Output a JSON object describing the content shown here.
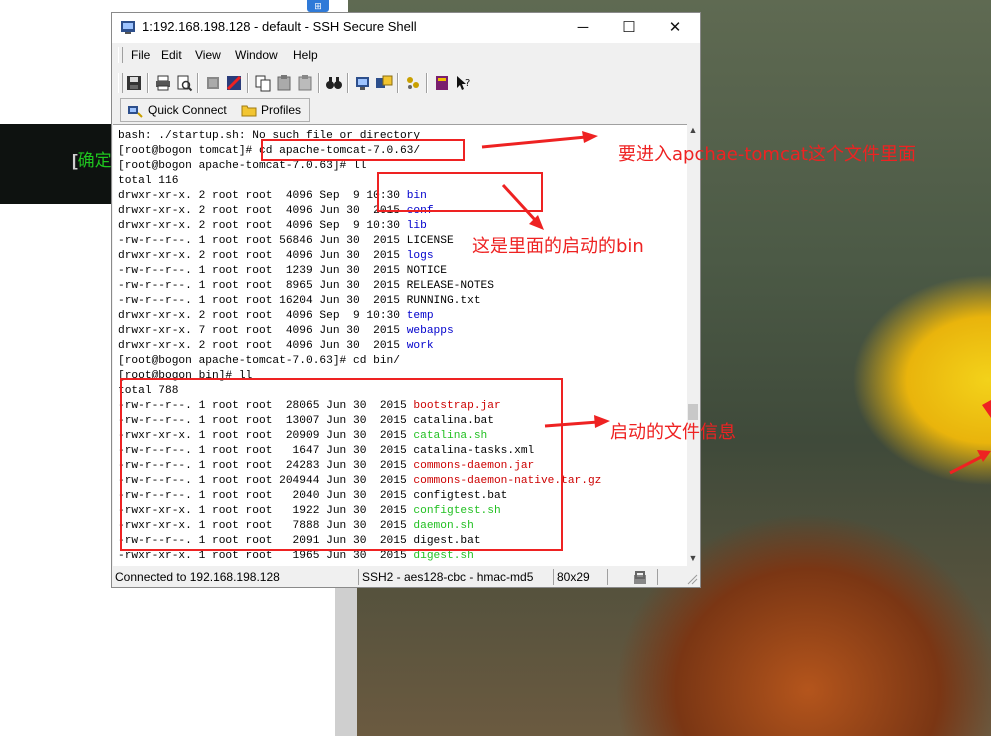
{
  "window": {
    "title": "1:192.168.198.128 - default - SSH Secure Shell",
    "min_glyph": "─",
    "max_glyph": "☐",
    "close_glyph": "✕"
  },
  "menu": [
    "File",
    "Edit",
    "View",
    "Window",
    "Help"
  ],
  "toolbar_icons": [
    "save-icon",
    "print-icon",
    "print-preview-icon",
    "find-icon",
    "settings-icon",
    "copy-icon",
    "paste-icon",
    "paste-alt-icon",
    "binoculars-icon",
    "new-terminal-icon",
    "file-transfer-icon",
    "profiles-icon",
    "book-icon",
    "help-icon"
  ],
  "quickbar": {
    "quick_connect": "Quick Connect",
    "profiles": "Profiles"
  },
  "terminal": {
    "lines": [
      [
        {
          "t": "bash: ./startup.sh: No such file or directory"
        }
      ],
      [
        {
          "t": "[root@bogon tomcat]# cd apache-tomcat-7.0.63/"
        }
      ],
      [
        {
          "t": "[root@bogon apache-tomcat-7.0.63]# ll"
        }
      ],
      [
        {
          "t": "total 116"
        }
      ],
      [
        {
          "t": "drwxr-xr-x. 2 root root  4096 Sep  9 10:30 "
        },
        {
          "t": "bin",
          "c": "c-blue"
        }
      ],
      [
        {
          "t": "drwxr-xr-x. 2 root root  4096 Jun 30  2015 "
        },
        {
          "t": "conf",
          "c": "c-blue"
        }
      ],
      [
        {
          "t": "drwxr-xr-x. 2 root root  4096 Sep  9 10:30 "
        },
        {
          "t": "lib",
          "c": "c-blue"
        }
      ],
      [
        {
          "t": "-rw-r--r--. 1 root root 56846 Jun 30  2015 LICENSE"
        }
      ],
      [
        {
          "t": "drwxr-xr-x. 2 root root  4096 Jun 30  2015 "
        },
        {
          "t": "logs",
          "c": "c-blue"
        }
      ],
      [
        {
          "t": "-rw-r--r--. 1 root root  1239 Jun 30  2015 NOTICE"
        }
      ],
      [
        {
          "t": "-rw-r--r--. 1 root root  8965 Jun 30  2015 RELEASE-NOTES"
        }
      ],
      [
        {
          "t": "-rw-r--r--. 1 root root 16204 Jun 30  2015 RUNNING.txt"
        }
      ],
      [
        {
          "t": "drwxr-xr-x. 2 root root  4096 Sep  9 10:30 "
        },
        {
          "t": "temp",
          "c": "c-blue"
        }
      ],
      [
        {
          "t": "drwxr-xr-x. 7 root root  4096 Jun 30  2015 "
        },
        {
          "t": "webapps",
          "c": "c-blue"
        }
      ],
      [
        {
          "t": "drwxr-xr-x. 2 root root  4096 Jun 30  2015 "
        },
        {
          "t": "work",
          "c": "c-blue"
        }
      ],
      [
        {
          "t": "[root@bogon apache-tomcat-7.0.63]# cd bin/"
        }
      ],
      [
        {
          "t": "[root@bogon bin]# ll"
        }
      ],
      [
        {
          "t": "total 788"
        }
      ],
      [
        {
          "t": "-rw-r--r--. 1 root root  28065 Jun 30  2015 "
        },
        {
          "t": "bootstrap.jar",
          "c": "c-red"
        }
      ],
      [
        {
          "t": "-rw-r--r--. 1 root root  13007 Jun 30  2015 catalina.bat"
        }
      ],
      [
        {
          "t": "-rwxr-xr-x. 1 root root  20909 Jun 30  2015 "
        },
        {
          "t": "catalina.sh",
          "c": "c-green"
        }
      ],
      [
        {
          "t": "-rw-r--r--. 1 root root   1647 Jun 30  2015 catalina-tasks.xml"
        }
      ],
      [
        {
          "t": "-rw-r--r--. 1 root root  24283 Jun 30  2015 "
        },
        {
          "t": "commons-daemon.jar",
          "c": "c-red"
        }
      ],
      [
        {
          "t": "-rw-r--r--. 1 root root 204944 Jun 30  2015 "
        },
        {
          "t": "commons-daemon-native.tar.gz",
          "c": "c-red"
        }
      ],
      [
        {
          "t": "-rw-r--r--. 1 root root   2040 Jun 30  2015 configtest.bat"
        }
      ],
      [
        {
          "t": "-rwxr-xr-x. 1 root root   1922 Jun 30  2015 "
        },
        {
          "t": "configtest.sh",
          "c": "c-green"
        }
      ],
      [
        {
          "t": "-rwxr-xr-x. 1 root root   7888 Jun 30  2015 "
        },
        {
          "t": "daemon.sh",
          "c": "c-green"
        }
      ],
      [
        {
          "t": "-rw-r--r--. 1 root root   2091 Jun 30  2015 digest.bat"
        }
      ],
      [
        {
          "t": "-rwxr-xr-x. 1 root root   1965 Jun 30  2015 "
        },
        {
          "t": "digest.sh",
          "c": "c-green"
        }
      ]
    ]
  },
  "status": {
    "connection": "Connected to 192.168.198.128",
    "cipher": "SSH2 - aes128-cbc - hmac-md5",
    "size": "80x29"
  },
  "annotations": {
    "enter_dir": "要进入apchae-tomcat这个文件里面",
    "bin_note": "这是里面的启动的bin",
    "files_note": "启动的文件信息"
  },
  "background": {
    "left_terminal_text_prefix": "[",
    "left_terminal_text": "确定"
  },
  "colors": {
    "annotation": "#ee2222",
    "dir": "#0000cc",
    "exec": "#22c022",
    "archive": "#cc0000"
  }
}
